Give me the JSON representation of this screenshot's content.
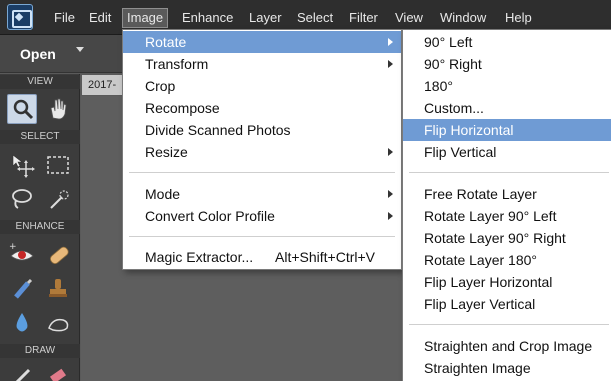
{
  "menubar": {
    "items": [
      "File",
      "Edit",
      "Image",
      "Enhance",
      "Layer",
      "Select",
      "Filter",
      "View",
      "Window",
      "Help"
    ],
    "active_index": 2
  },
  "toolbar": {
    "open_label": "Open"
  },
  "document": {
    "tab_label": "2017-"
  },
  "panel": {
    "sections": [
      "VIEW",
      "SELECT",
      "ENHANCE",
      "DRAW"
    ],
    "tools": [
      "zoom-tool",
      "hand-tool",
      "move-tool",
      "marquee-tool",
      "lasso-tool",
      "quick-selection-tool",
      "red-eye-tool",
      "healing-brush-tool",
      "smart-brush-tool",
      "clone-stamp-tool",
      "blur-tool",
      "smudge-tool",
      "brush-tool",
      "eraser-tool"
    ]
  },
  "image_menu": {
    "items": [
      {
        "label": "Rotate",
        "submenu": true,
        "highlight": true
      },
      {
        "label": "Transform",
        "submenu": true
      },
      {
        "label": "Crop"
      },
      {
        "label": "Recompose"
      },
      {
        "label": "Divide Scanned Photos"
      },
      {
        "label": "Resize",
        "submenu": true
      },
      {
        "label": "Mode",
        "submenu": true
      },
      {
        "label": "Convert Color Profile",
        "submenu": true
      },
      {
        "label": "Magic Extractor...",
        "shortcut": "Alt+Shift+Ctrl+V"
      }
    ]
  },
  "rotate_menu": {
    "items": [
      {
        "label": "90° Left"
      },
      {
        "label": "90° Right"
      },
      {
        "label": "180°"
      },
      {
        "label": "Custom..."
      },
      {
        "label": "Flip Horizontal",
        "highlight": true
      },
      {
        "label": "Flip Vertical"
      },
      {
        "label": "Free Rotate Layer"
      },
      {
        "label": "Rotate Layer 90° Left"
      },
      {
        "label": "Rotate Layer 90° Right"
      },
      {
        "label": "Rotate Layer 180°"
      },
      {
        "label": "Flip Layer Horizontal"
      },
      {
        "label": "Flip Layer Vertical"
      },
      {
        "label": "Straighten and Crop Image"
      },
      {
        "label": "Straighten Image"
      }
    ]
  },
  "colors": {
    "highlight": "#6f9bd4",
    "menubar": "#2e2e2e",
    "panel": "#3c3c3c"
  }
}
